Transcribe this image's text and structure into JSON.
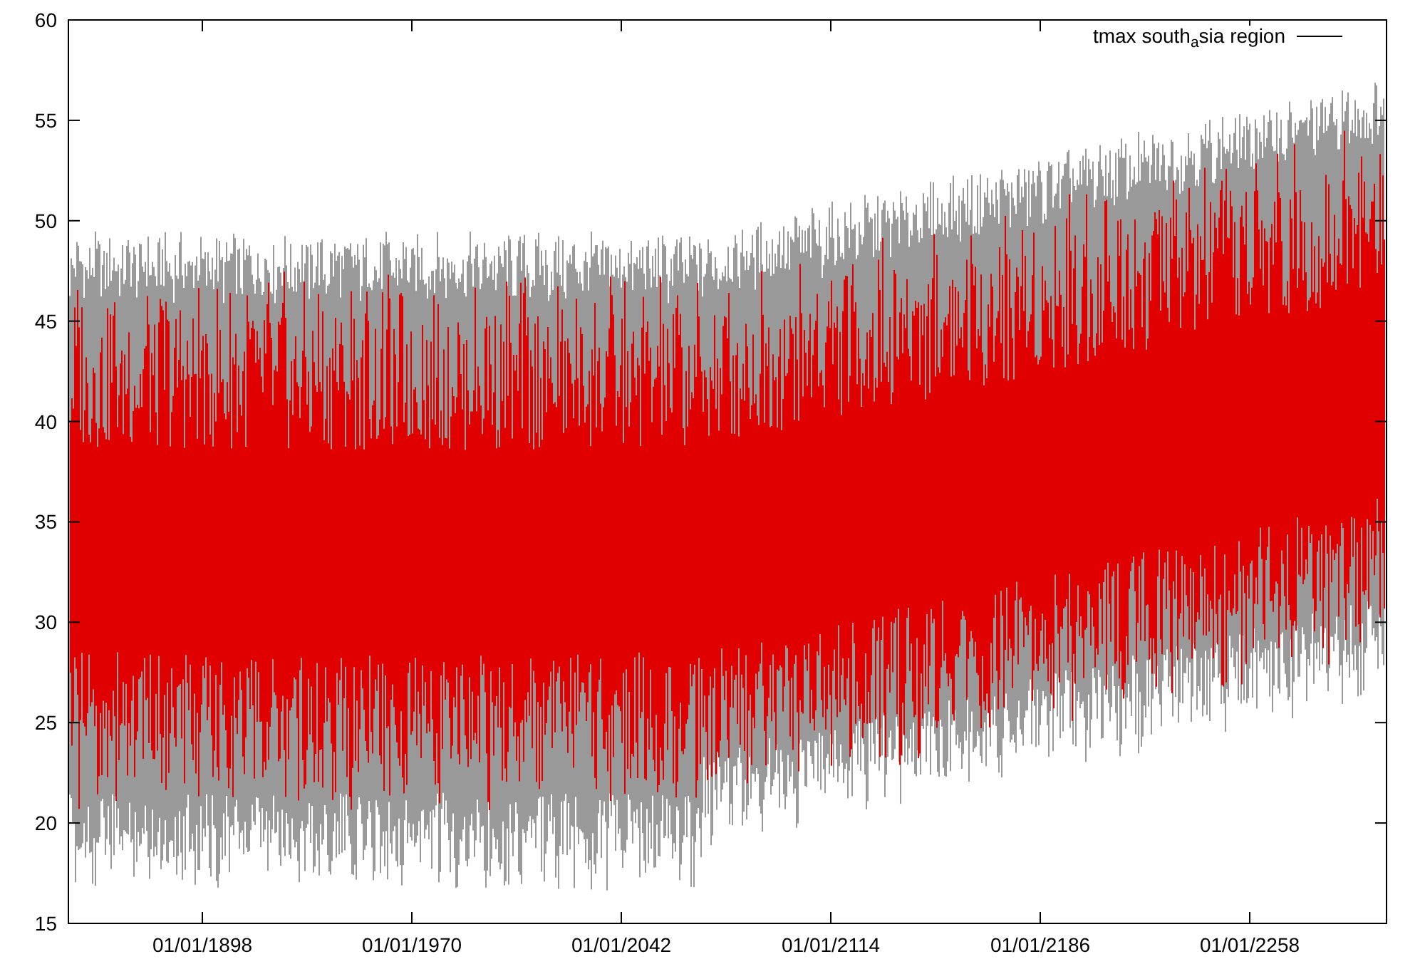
{
  "plot": {
    "legend": "tmax south$_{a}$sia region",
    "yticks": [
      "60",
      "55",
      "50",
      "45",
      "40",
      "35",
      "30",
      "25",
      "20",
      "15"
    ],
    "xticks": [
      "01/01/1898",
      "01/01/1970",
      "01/01/2042",
      "01/01/2114",
      "01/01/2186",
      "01/01/2258"
    ]
  }
}
